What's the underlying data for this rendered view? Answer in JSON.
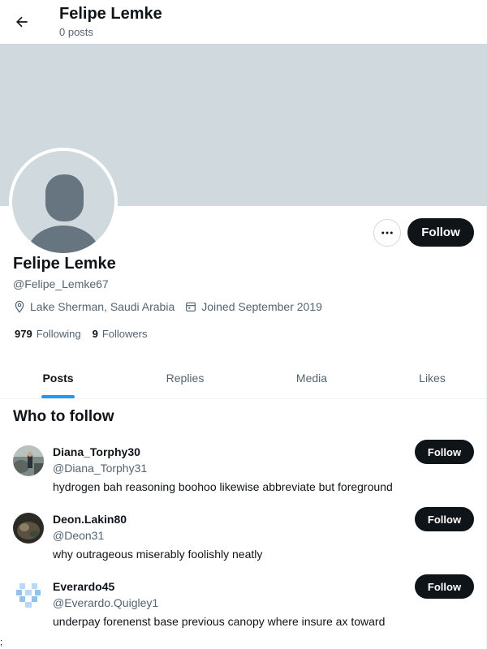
{
  "header": {
    "back_icon": "arrow-left-icon",
    "title": "Felipe Lemke",
    "subtitle": "0 posts"
  },
  "profile": {
    "name": "Felipe Lemke",
    "handle": "@Felipe_Lemke67",
    "location": "Lake Sherman, Saudi Arabia",
    "joined": "Joined September 2019",
    "following_count": "979",
    "following_label": "Following",
    "followers_count": "9",
    "followers_label": "Followers",
    "more_icon": "more-horizontal-icon",
    "follow_label": "Follow",
    "banner_color": "#cfd9de"
  },
  "tabs": [
    {
      "label": "Posts",
      "active": true
    },
    {
      "label": "Replies",
      "active": false
    },
    {
      "label": "Media",
      "active": false
    },
    {
      "label": "Likes",
      "active": false
    }
  ],
  "who_to_follow": {
    "title": "Who to follow",
    "items": [
      {
        "name": "Diana_Torphy30",
        "handle": "@Diana_Torphy31",
        "bio": "hydrogen bah reasoning boohoo likewise abbreviate but foreground",
        "follow_label": "Follow"
      },
      {
        "name": "Deon.Lakin80",
        "handle": "@Deon31",
        "bio": "why outrageous miserably foolishly neatly",
        "follow_label": "Follow"
      },
      {
        "name": "Everardo45",
        "handle": "@Everardo.Quigley1",
        "bio": "underpay forenenst base previous canopy where insure ax toward",
        "follow_label": "Follow"
      }
    ]
  },
  "stray_char": ";",
  "colors": {
    "accent": "#1d9bf0",
    "dark": "#0f1419",
    "muted": "#536471"
  }
}
